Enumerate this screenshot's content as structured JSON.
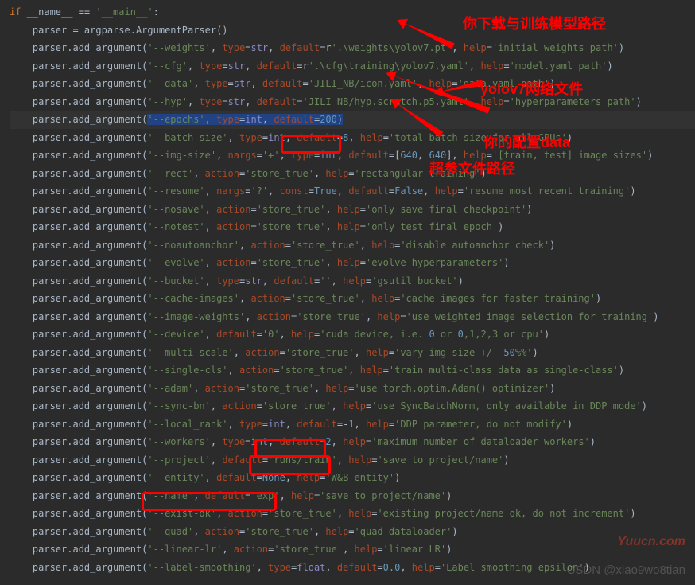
{
  "guard": {
    "if": "if",
    "name": "__name__",
    "eq": "==",
    "main": "'__main__'"
  },
  "parser_init": "parser = argparse.ArgumentParser()",
  "lines": [
    {
      "flag": "'--weights'",
      "rest": ", type=str, default=r'.\\weights\\yolov7.pt', help='initial weights path')"
    },
    {
      "flag": "'--cfg'",
      "rest": ", type=str, default=r'.\\cfg\\training\\yolov7.yaml', help='model.yaml path')"
    },
    {
      "flag": "'--data'",
      "rest": ", type=str, default='JILI_NB/icon.yaml', help='data.yaml path')"
    },
    {
      "flag": "'--hyp'",
      "rest": ", type=str, default='JILI_NB/hyp.scratch.p5.yaml', help='hyperparameters path')"
    },
    {
      "flag": "'--epochs'",
      "rest": ", type=int, default=200)"
    },
    {
      "flag": "'--batch-size'",
      "rest": ", type=int, default=8, help='total batch size for all GPUs')"
    },
    {
      "flag": "'--img-size'",
      "rest": ", nargs='+', type=int, default=[640, 640], help='[train, test] image sizes')"
    },
    {
      "flag": "'--rect'",
      "rest": ", action='store_true', help='rectangular training')"
    },
    {
      "flag": "'--resume'",
      "rest": ", nargs='?', const=True, default=False, help='resume most recent training')"
    },
    {
      "flag": "'--nosave'",
      "rest": ", action='store_true', help='only save final checkpoint')"
    },
    {
      "flag": "'--notest'",
      "rest": ", action='store_true', help='only test final epoch')"
    },
    {
      "flag": "'--noautoanchor'",
      "rest": ", action='store_true', help='disable autoanchor check')"
    },
    {
      "flag": "'--evolve'",
      "rest": ", action='store_true', help='evolve hyperparameters')"
    },
    {
      "flag": "'--bucket'",
      "rest": ", type=str, default='', help='gsutil bucket')"
    },
    {
      "flag": "'--cache-images'",
      "rest": ", action='store_true', help='cache images for faster training')"
    },
    {
      "flag": "'--image-weights'",
      "rest": ", action='store_true', help='use weighted image selection for training')"
    },
    {
      "flag": "'--device'",
      "rest": ", default='0', help='cuda device, i.e. 0 or 0,1,2,3 or cpu')"
    },
    {
      "flag": "'--multi-scale'",
      "rest": ", action='store_true', help='vary img-size +/- 50%%')"
    },
    {
      "flag": "'--single-cls'",
      "rest": ", action='store_true', help='train multi-class data as single-class')"
    },
    {
      "flag": "'--adam'",
      "rest": ", action='store_true', help='use torch.optim.Adam() optimizer')"
    },
    {
      "flag": "'--sync-bn'",
      "rest": ", action='store_true', help='use SyncBatchNorm, only available in DDP mode')"
    },
    {
      "flag": "'--local_rank'",
      "rest": ", type=int, default=-1, help='DDP parameter, do not modify')"
    },
    {
      "flag": "'--workers'",
      "rest": ", type=int, default=2, help='maximum number of dataloader workers')"
    },
    {
      "flag": "'--project'",
      "rest": ", default='runs/train', help='save to project/name')"
    },
    {
      "flag": "'--entity'",
      "rest": ", default=None, help='W&B entity')"
    },
    {
      "flag": "'--name'",
      "rest": ", default='exp', help='save to project/name')"
    },
    {
      "flag": "'--exist-ok'",
      "rest": ", action='store_true', help='existing project/name ok, do not increment')"
    },
    {
      "flag": "'--quad'",
      "rest": ", action='store_true', help='quad dataloader')"
    },
    {
      "flag": "'--linear-lr'",
      "rest": ", action='store_true', help='linear LR')"
    },
    {
      "flag": "'--label-smoothing'",
      "rest": ", type=float, default=0.0, help='Label smoothing epsilon')"
    }
  ],
  "annotations": {
    "a1": "你下载与训练模型路径",
    "a2": "yolov7网络文件",
    "a3": "你的配置data",
    "a4": "超参文件路径"
  },
  "watermarks": {
    "yuucn": "Yuucn.com",
    "csdn": "CSDN @xiao9wo8tian"
  }
}
